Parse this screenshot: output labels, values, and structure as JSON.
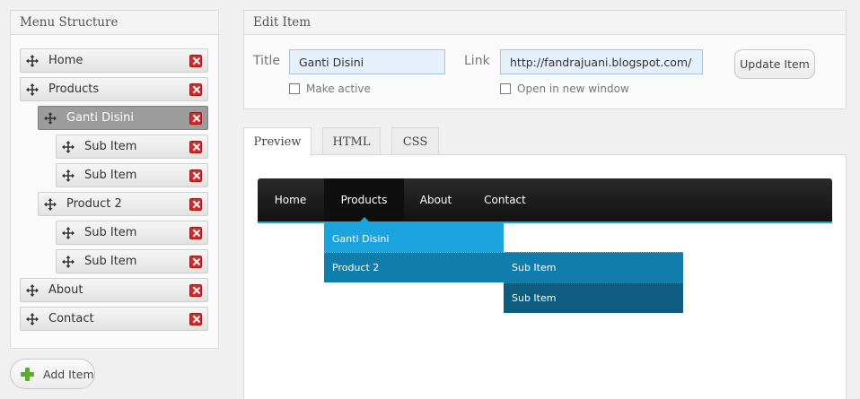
{
  "menu_panel": {
    "title": "Menu Structure",
    "items": [
      {
        "label": "Home"
      },
      {
        "label": "Products"
      },
      {
        "label": "Ganti Disini"
      },
      {
        "label": "Sub Item"
      },
      {
        "label": "Sub Item"
      },
      {
        "label": "Product 2"
      },
      {
        "label": "Sub Item"
      },
      {
        "label": "Sub Item"
      },
      {
        "label": "About"
      },
      {
        "label": "Contact"
      }
    ],
    "add_label": "Add Item"
  },
  "edit_panel": {
    "title": "Edit Item",
    "title_label": "Title",
    "title_value": "Ganti Disini",
    "link_label": "Link",
    "link_value": "http://fandrajuani.blogspot.com/",
    "make_active_label": "Make active",
    "new_window_label": "Open in new window",
    "update_label": "Update Item"
  },
  "tabs": [
    {
      "label": "Preview"
    },
    {
      "label": "HTML"
    },
    {
      "label": "CSS"
    }
  ],
  "preview": {
    "nav": [
      "Home",
      "Products",
      "About",
      "Contact"
    ],
    "dropdown": {
      "level1": [
        "Ganti Disini",
        "Product 2"
      ],
      "level2": [
        "Sub Item",
        "Sub Item"
      ]
    }
  },
  "colors": {
    "accent": "#1aa3dd",
    "dropdown_level1": "#1aa3dd",
    "dropdown_level1_alt": "#117dad",
    "dropdown_level2": "#0e5c80",
    "delete_red": "#d62a2a",
    "add_green": "#5aac2b"
  },
  "icons": {
    "move": "move-icon",
    "delete": "delete-icon",
    "add": "add-icon"
  }
}
